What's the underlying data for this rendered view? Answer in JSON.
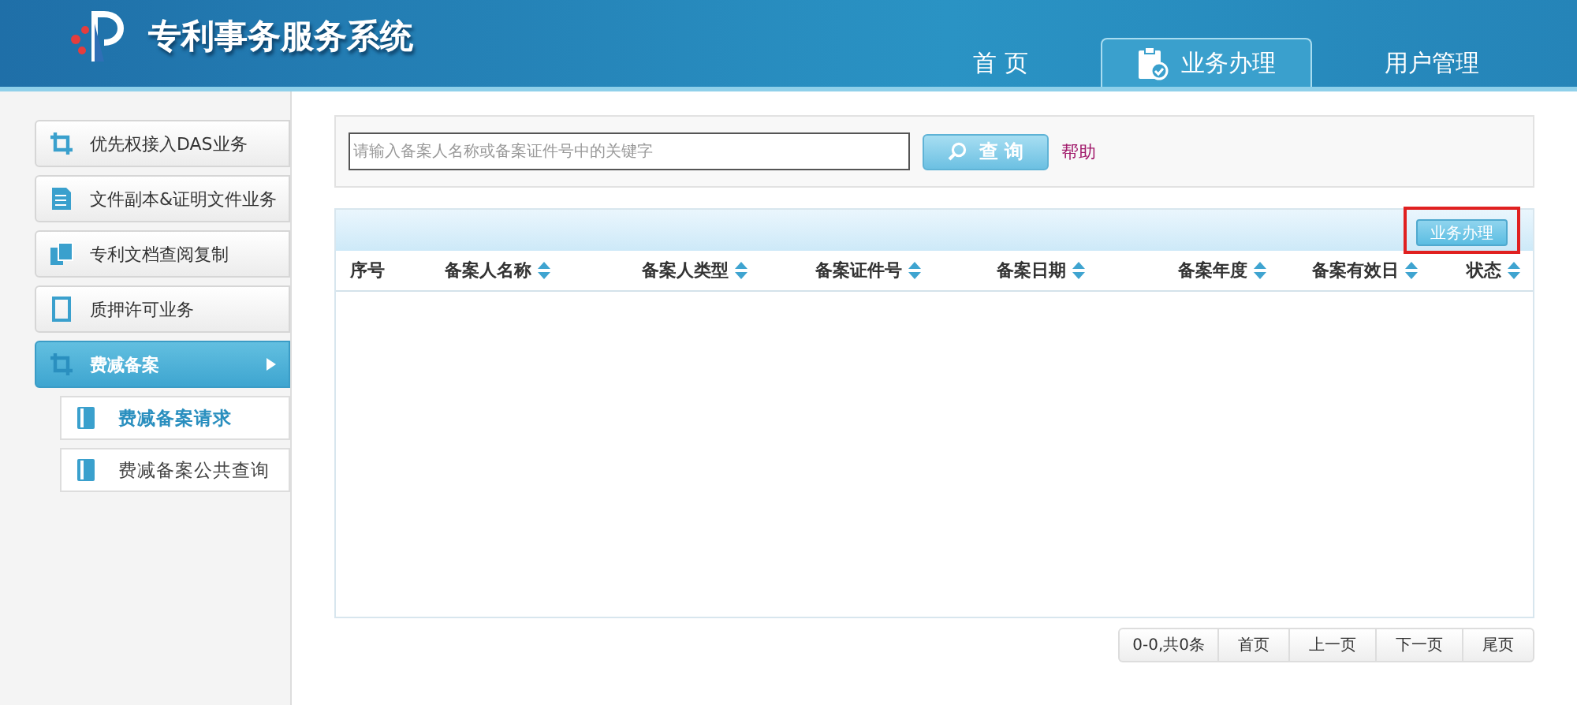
{
  "header": {
    "title": "专利事务服务系统",
    "nav": [
      {
        "label": "首 页",
        "selected": false,
        "icon": false
      },
      {
        "label": "业务办理",
        "selected": true,
        "icon": true
      },
      {
        "label": "用户管理",
        "selected": false,
        "icon": false
      }
    ]
  },
  "sidebar": {
    "items": [
      {
        "label": "优先权接入DAS业务",
        "kind": "crop",
        "selected": false
      },
      {
        "label": "文件副本&证明文件业务",
        "kind": "doc",
        "selected": false
      },
      {
        "label": "专利文档查阅复制",
        "kind": "copy",
        "selected": false
      },
      {
        "label": "质押许可业务",
        "kind": "page",
        "selected": false
      },
      {
        "label": "费减备案",
        "kind": "crop",
        "selected": true,
        "expanded": true,
        "children": [
          {
            "label": "费减备案请求",
            "selected": true
          },
          {
            "label": "费减备案公共查询",
            "selected": false
          }
        ]
      }
    ]
  },
  "search": {
    "placeholder": "请输入备案人名称或备案证件号中的关键字",
    "button": "查 询",
    "help": "帮助"
  },
  "table": {
    "action_button": {
      "label": "业务办理",
      "highlighted": true
    },
    "columns": [
      {
        "label": "序号",
        "sortable": false
      },
      {
        "label": "备案人名称",
        "sortable": true
      },
      {
        "label": "备案人类型",
        "sortable": true
      },
      {
        "label": "备案证件号",
        "sortable": true
      },
      {
        "label": "备案日期",
        "sortable": true
      },
      {
        "label": "备案年度",
        "sortable": true
      },
      {
        "label": "备案有效日",
        "sortable": true
      },
      {
        "label": "状态",
        "sortable": true
      }
    ]
  },
  "pagination": {
    "summary": "0-0,共0条",
    "buttons": [
      "首页",
      "上一页",
      "下一页",
      "尾页"
    ]
  }
}
